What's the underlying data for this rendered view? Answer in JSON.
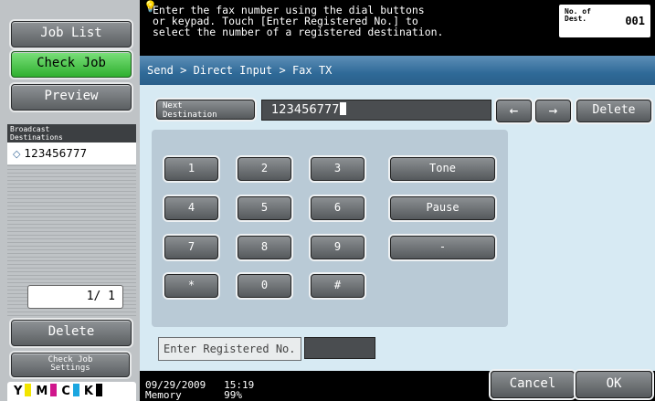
{
  "sidebar": {
    "job_list": "Job List",
    "check_job": "Check Job",
    "preview": "Preview",
    "broadcast_header": [
      "Broadcast",
      "Destinations"
    ],
    "destinations": [
      "123456777"
    ],
    "pager": "1/ 1",
    "delete": "Delete",
    "check_job_settings": [
      "Check Job",
      "Settings"
    ],
    "toner": [
      {
        "label": "Y",
        "color": "#f2e500"
      },
      {
        "label": "M",
        "color": "#d0168c"
      },
      {
        "label": "C",
        "color": "#1aa6e0"
      },
      {
        "label": "K",
        "color": "#000000"
      }
    ]
  },
  "message": {
    "lines": [
      "Enter the fax number using the dial buttons",
      "or keypad. Touch [Enter Registered No.] to",
      "select the number of a registered destination."
    ],
    "num_dest_label": [
      "No. of",
      "Dest."
    ],
    "num_dest_value": "001"
  },
  "main": {
    "breadcrumb": "Send > Direct Input > Fax TX",
    "next_destination": [
      "Next",
      "Destination"
    ],
    "fax_number": "123456777",
    "arrow_left": "←",
    "arrow_right": "→",
    "delete": "Delete",
    "keys": [
      "1",
      "2",
      "3",
      "4",
      "5",
      "6",
      "7",
      "8",
      "9",
      "*",
      "0",
      "#"
    ],
    "tone": "Tone",
    "pause": "Pause",
    "dash": "-",
    "enter_registered": "Enter Registered No."
  },
  "status": {
    "date": "09/29/2009",
    "time": "15:19",
    "memory_label": "Memory",
    "memory_value": "99%"
  },
  "actions": {
    "cancel": "Cancel",
    "ok": "OK"
  },
  "colors": {
    "accent_green": "#3cbf3c",
    "header_blue": "#2f6a98",
    "panel_bg": "#d7eaf3"
  }
}
